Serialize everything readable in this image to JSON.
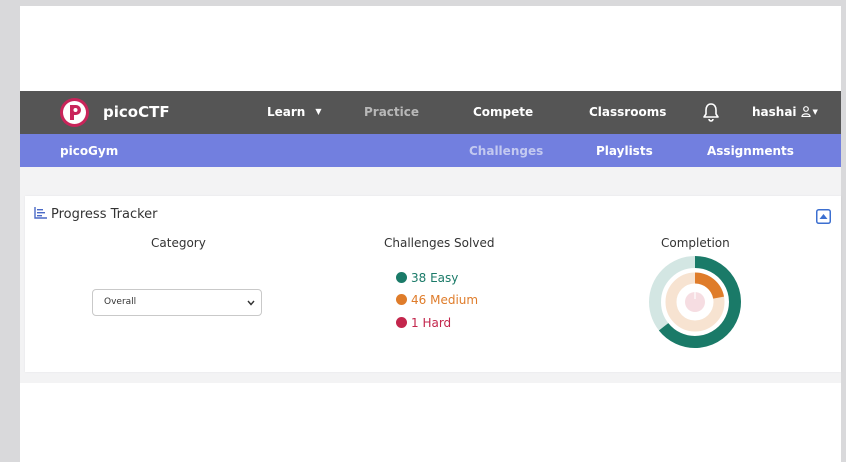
{
  "nav": {
    "brand": "picoCTF",
    "learn": "Learn",
    "practice": "Practice",
    "compete": "Compete",
    "classrooms": "Classrooms",
    "username": "hashai"
  },
  "subnav": {
    "brand": "picoGym",
    "challenges": "Challenges",
    "playlists": "Playlists",
    "assignments": "Assignments"
  },
  "tracker": {
    "title": "Progress Tracker",
    "category_heading": "Category",
    "solved_heading": "Challenges Solved",
    "completion_heading": "Completion",
    "category_value": "Overall",
    "solved": [
      {
        "label": "38 Easy",
        "count": 38,
        "color": "#1a7a68"
      },
      {
        "label": "46 Medium",
        "count": 46,
        "color": "#df7c2a"
      },
      {
        "label": "1 Hard",
        "count": 1,
        "color": "#c3264c"
      }
    ]
  },
  "colors": {
    "nav_bg": "#555555",
    "subnav_bg": "#727fdf",
    "easy": "#1a7a68",
    "medium": "#df7c2a",
    "hard": "#c3264c"
  },
  "icons": [
    "picoctf-logo-icon",
    "chevron-down-icon",
    "bell-icon",
    "user-icon",
    "bar-chart-icon",
    "collapse-icon"
  ]
}
